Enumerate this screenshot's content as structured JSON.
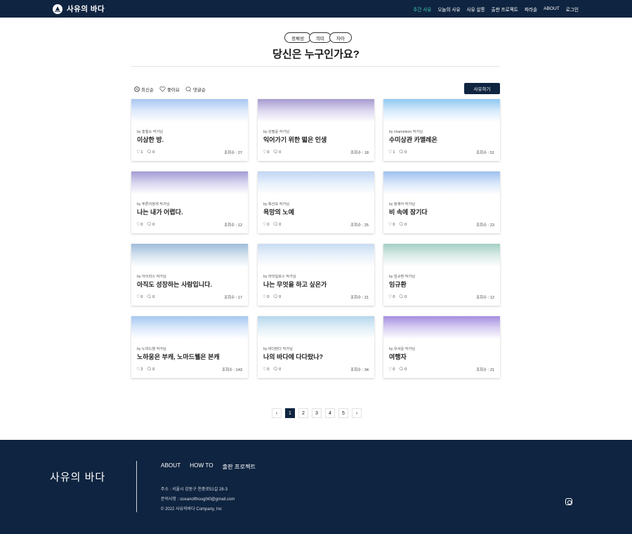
{
  "nav": {
    "brand": "사유의 바다",
    "items": [
      "주간 사유",
      "오늘의 사유",
      "사유 살롱",
      "출판 프로젝트",
      "파라솔",
      "ABOUT",
      "로그인"
    ]
  },
  "tags": [
    "정체성",
    "의미",
    "자아"
  ],
  "page_title": "당신은 누구인가요?",
  "sort": {
    "latest": "최신순",
    "likes": "좋아요",
    "comments": "댓글순"
  },
  "write_button": "사유하기",
  "cards": [
    {
      "author": "by 홍철소 작가님",
      "title": "이상한 방.",
      "likes": "1",
      "comments": "0",
      "views": "조회수 : 27",
      "grad": "#a9c7f0,#dde9fb,#fff"
    },
    {
      "author": "by 강필윤 작가님",
      "title": "익어가기 위한 떫은 인생",
      "likes": "0",
      "comments": "0",
      "views": "조회수 : 18",
      "grad": "#a79bd0,#ddd7ef,#fff"
    },
    {
      "author": "by chameleon 작가님",
      "title": "수미상관 카멜레온",
      "likes": "1",
      "comments": "0",
      "views": "조회수 : 51",
      "grad": "#8fc8f2,#d6ebfb,#fff"
    },
    {
      "author": "by 푸른의정게 작가님",
      "title": "나는 내가 어렵다.",
      "likes": "0",
      "comments": "0",
      "views": "조회수 : 12",
      "grad": "#a39cd4,#d9d6ef,#fff"
    },
    {
      "author": "by 혹산또 작가님",
      "title": "욕망의 노예",
      "likes": "0",
      "comments": "0",
      "views": "조회수 : 25",
      "grad": "#c0d6f3,#e6effb,#fff"
    },
    {
      "author": "by 정재아 작가님",
      "title": "비 속에 잠기다",
      "likes": "0",
      "comments": "0",
      "views": "조회수 : 23",
      "grad": "#9ec0ee,#d8e6fa,#fff"
    },
    {
      "author": "by 아이리스 작가님",
      "title": "아직도 성장하는 사람입니다.",
      "likes": "0",
      "comments": "0",
      "views": "조회수 : 17",
      "grad": "#9ebcd8,#d5e3ef,#fff"
    },
    {
      "author": "by 라미일포스 작가님",
      "title": "나는 무엇을 하고 싶은가",
      "likes": "0",
      "comments": "0",
      "views": "조회수 : 21",
      "grad": "#c8dcf2,#e9f1fa,#fff"
    },
    {
      "author": "by 임규환 작가님",
      "title": "임규환",
      "likes": "0",
      "comments": "0",
      "views": "조회수 : 12",
      "grad": "#a4cfc4,#dbece8,#fff"
    },
    {
      "author": "by 노마드웰 작가님",
      "title": "노하웅은 부캐, 노마드웰은 본캐",
      "likes": "2",
      "comments": "0",
      "views": "조회수 : 143",
      "grad": "#a6c8f1,#dbe9fb,#fff"
    },
    {
      "author": "by 바다판다 작가님",
      "title": "나의 바다에 다다랐나?",
      "likes": "0",
      "comments": "0",
      "views": "조회수 : 34",
      "grad": "#b5d7ec,#e2eff8,#fff"
    },
    {
      "author": "by 유서윤 작가님",
      "title": "여행자",
      "likes": "0",
      "comments": "0",
      "views": "조회수 : 21",
      "grad": "#a58fe0,#d9cff3,#fff"
    }
  ],
  "pagination": {
    "prev": "‹",
    "pages": [
      "1",
      "2",
      "3",
      "4",
      "5"
    ],
    "current": "1",
    "next": "›"
  },
  "footer": {
    "brand": "사유의 바다",
    "links": [
      "ABOUT",
      "HOW TO",
      "출판 프로젝트"
    ],
    "address": "주소 : 서울시 강동구 천중로51길 28-3",
    "contact": "문의사항 : oceanofthought0@gmail.com",
    "copyright": "© 2022 사유의바다 Company, Inc"
  }
}
